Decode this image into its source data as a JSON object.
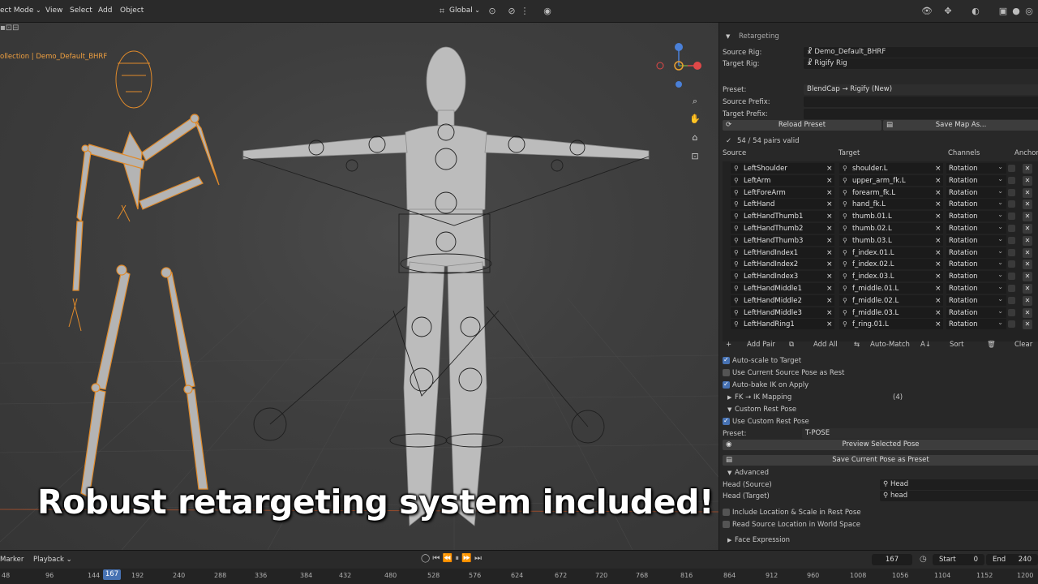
{
  "header": {
    "mode": "ect Mode",
    "menus": [
      "View",
      "Select",
      "Add",
      "Object"
    ],
    "transform_orientation": "Global"
  },
  "viewport": {
    "collection_label": "ollection | Demo_Default_BHRF",
    "caption": "Robust retargeting system included!",
    "gizmo_colors": {
      "x": "#e04848",
      "y": "#5a9e3a",
      "z": "#4a80d8"
    }
  },
  "panel": {
    "section_title": "Retargeting",
    "source_rig_label": "Source Rig:",
    "source_rig_value": "Demo_Default_BHRF",
    "target_rig_label": "Target Rig:",
    "target_rig_value": "Rigify Rig",
    "preset_label": "Preset:",
    "preset_value": "BlendCap → Rigify (New)",
    "source_prefix_label": "Source Prefix:",
    "target_prefix_label": "Target Prefix:",
    "reload_preset": "Reload Preset",
    "save_map_as": "Save Map As...",
    "valid_status": "54 / 54 pairs valid",
    "col_source": "Source",
    "col_target": "Target",
    "col_channels": "Channels",
    "col_anchor": "Anchor",
    "pairs": [
      {
        "source": "LeftShoulder",
        "target": "shoulder.L",
        "channel": "Rotation"
      },
      {
        "source": "LeftArm",
        "target": "upper_arm_fk.L",
        "channel": "Rotation"
      },
      {
        "source": "LeftForeArm",
        "target": "forearm_fk.L",
        "channel": "Rotation"
      },
      {
        "source": "LeftHand",
        "target": "hand_fk.L",
        "channel": "Rotation"
      },
      {
        "source": "LeftHandThumb1",
        "target": "thumb.01.L",
        "channel": "Rotation"
      },
      {
        "source": "LeftHandThumb2",
        "target": "thumb.02.L",
        "channel": "Rotation"
      },
      {
        "source": "LeftHandThumb3",
        "target": "thumb.03.L",
        "channel": "Rotation"
      },
      {
        "source": "LeftHandIndex1",
        "target": "f_index.01.L",
        "channel": "Rotation"
      },
      {
        "source": "LeftHandIndex2",
        "target": "f_index.02.L",
        "channel": "Rotation"
      },
      {
        "source": "LeftHandIndex3",
        "target": "f_index.03.L",
        "channel": "Rotation"
      },
      {
        "source": "LeftHandMiddle1",
        "target": "f_middle.01.L",
        "channel": "Rotation"
      },
      {
        "source": "LeftHandMiddle2",
        "target": "f_middle.02.L",
        "channel": "Rotation"
      },
      {
        "source": "LeftHandMiddle3",
        "target": "f_middle.03.L",
        "channel": "Rotation"
      },
      {
        "source": "LeftHandRing1",
        "target": "f_ring.01.L",
        "channel": "Rotation"
      }
    ],
    "add_pair": "Add Pair",
    "add_all": "Add All",
    "auto_match": "Auto-Match",
    "sort": "Sort",
    "clear": "Clear",
    "auto_scale": "Auto-scale to Target",
    "use_current_source": "Use Current Source Pose as Rest",
    "auto_bake": "Auto-bake IK on Apply",
    "fk_ik_mapping": "FK → IK Mapping",
    "fk_ik_count": "(4)",
    "custom_rest_pose": "Custom Rest Pose",
    "use_custom_rest": "Use Custom Rest Pose",
    "rest_preset_label": "Preset:",
    "rest_preset_value": "T-POSE",
    "preview_selected_pose": "Preview Selected Pose",
    "save_current_pose": "Save Current Pose as Preset",
    "advanced": "Advanced",
    "head_source_label": "Head (Source)",
    "head_source_value": "Head",
    "head_target_label": "Head (Target)",
    "head_target_value": "head",
    "include_location": "Include Location & Scale in Rest Pose",
    "read_source_location": "Read Source Location in World Space",
    "face_expression": "Face Expression"
  },
  "timeline": {
    "marker": "Marker",
    "playback": "Playback",
    "current_frame": "167",
    "start_label": "Start",
    "start_value": "0",
    "end_label": "End",
    "end_value": "240",
    "ticks": [
      "48",
      "96",
      "144",
      "167",
      "192",
      "240",
      "288",
      "336",
      "384",
      "432",
      "480",
      "528",
      "576",
      "624",
      "672",
      "720",
      "768",
      "816",
      "864",
      "912",
      "960",
      "1008",
      "1056",
      "1104",
      "1152",
      "1200"
    ]
  }
}
